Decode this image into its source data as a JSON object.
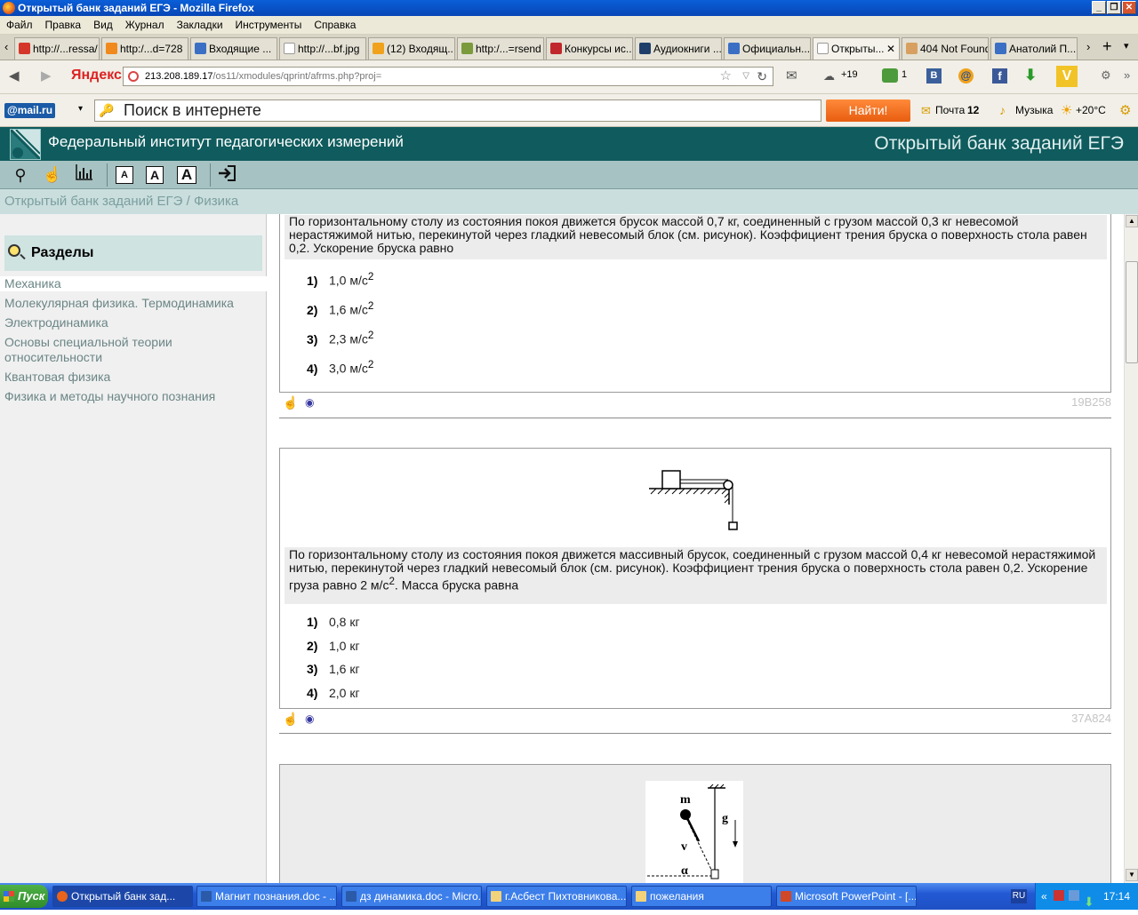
{
  "window": {
    "title": "Открытый банк заданий ЕГЭ - Mozilla Firefox"
  },
  "menu": [
    "Файл",
    "Правка",
    "Вид",
    "Журнал",
    "Закладки",
    "Инструменты",
    "Справка"
  ],
  "tabs": [
    {
      "label": "http://...ressa/",
      "color": "#d4372a"
    },
    {
      "label": "http:/...d=728",
      "color": "#f08a1c"
    },
    {
      "label": "Входящие ...",
      "color": "#3b6fc4"
    },
    {
      "label": "http://...bf.jpg",
      "color": "#ffffff"
    },
    {
      "label": "(12) Входящ...",
      "color": "#f0a21c"
    },
    {
      "label": "http:/...=rsend",
      "color": "#7a9a3c"
    },
    {
      "label": "Конкурсы ис...",
      "color": "#c0282b"
    },
    {
      "label": "Аудиокниги ...",
      "color": "#1f3f6a"
    },
    {
      "label": "Официальн...",
      "color": "#3b6fc4"
    },
    {
      "label": "Открыты...",
      "color": "#ffffff"
    },
    {
      "label": "404 Not Found",
      "color": "#d8a060"
    },
    {
      "label": "Анатолий П...",
      "color": "#3b6fc4"
    }
  ],
  "nav": {
    "brand": "Яндекс",
    "url_main": "213.208.189.17",
    "url_path": "/os11/xmodules/qprint/afrms.php?proj=",
    "cloud": "+19",
    "counter": "1"
  },
  "searchbar": {
    "brand": "@mail.ru",
    "placeholder": "Поиск в интернете",
    "find": "Найти!",
    "mail": "Почта",
    "mail_count": "12",
    "music": "Музыка",
    "weather": "+20°C"
  },
  "header": {
    "institute": "Федеральный институт педагогических измерений",
    "bank": "Открытый банк заданий ЕГЭ"
  },
  "toolbar": {
    "font_small": "A",
    "font_mid": "A",
    "font_large": "A"
  },
  "breadcrumb": "Открытый банк заданий ЕГЭ / Физика",
  "sidebar": {
    "title": "Разделы",
    "items": [
      "Механика",
      "Молекулярная физика. Термодинамика",
      "Электродинамика",
      "Основы специальной теории относительности",
      "Квантовая физика",
      "Физика и методы научного познания"
    ]
  },
  "questions": [
    {
      "text": "По горизонтальному столу из состояния покоя движется брусок массой 0,7 кг, соединенный с грузом массой 0,3 кг невесомой нерастяжимой нитью, перекинутой через гладкий невесомый блок (см. рисунок). Коэффициент трения бруска о поверхность стола равен 0,2. Ускорение бруска равно",
      "options": [
        {
          "n": "1)",
          "v": "1,0 м/с",
          "sup": "2"
        },
        {
          "n": "2)",
          "v": "1,6 м/с",
          "sup": "2"
        },
        {
          "n": "3)",
          "v": "2,3 м/с",
          "sup": "2"
        },
        {
          "n": "4)",
          "v": "3,0 м/с",
          "sup": "2"
        }
      ],
      "code": "19B258"
    },
    {
      "text_a": "По горизонтальному столу из состояния покоя движется массивный брусок, соединенный с грузом массой 0,4 кг невесомой нерастяжимой нитью, перекинутой через гладкий невесомый блок (см. рисунок). Коэффициент трения бруска о поверхность стола равен 0,2. Ускорение груза равно 2 м/с",
      "text_sup": "2",
      "text_b": ". Масса бруска равна",
      "options": [
        {
          "n": "1)",
          "v": "0,8 кг"
        },
        {
          "n": "2)",
          "v": "1,0 кг"
        },
        {
          "n": "3)",
          "v": "1,6 кг"
        },
        {
          "n": "4)",
          "v": "2,0 кг"
        }
      ],
      "code": "37A824"
    },
    {
      "fig_labels": {
        "m": "m",
        "v": "v",
        "g": "g",
        "alpha": "α"
      }
    }
  ],
  "taskbar": {
    "start": "Пуск",
    "tasks": [
      "Открытый банк зад...",
      "Магнит познания.doc - ...",
      "дз динамика.doc - Micro...",
      "г.Асбест Пихтовникова...",
      "пожелания",
      "Microsoft PowerPoint - [..."
    ],
    "lang": "RU",
    "time": "17:14"
  }
}
